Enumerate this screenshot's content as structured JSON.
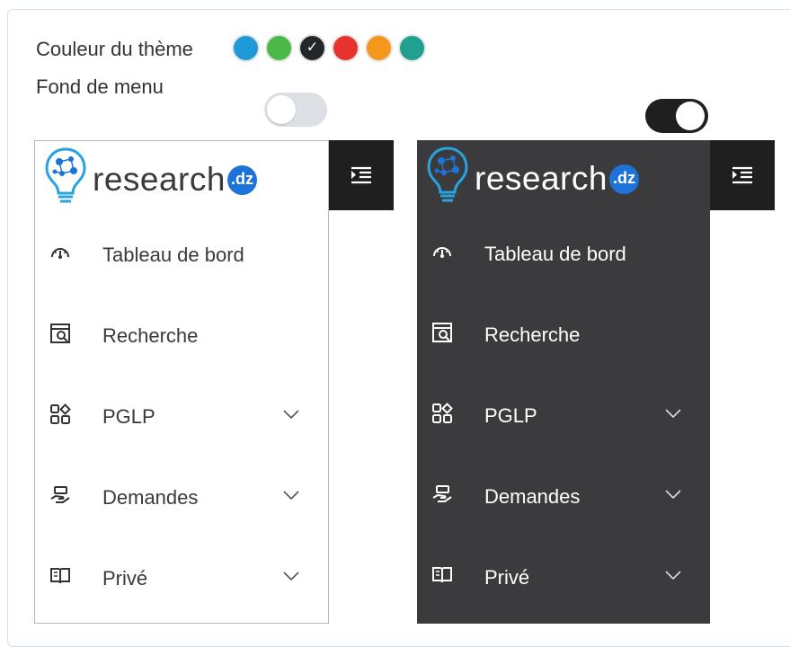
{
  "settings": {
    "theme_color_label": "Couleur du thème",
    "menu_background_label": "Fond de menu",
    "theme_colors": [
      {
        "name": "blue",
        "hex": "#1e9bd7",
        "selected": false
      },
      {
        "name": "green",
        "hex": "#4cb848",
        "selected": false
      },
      {
        "name": "black",
        "hex": "#23272b",
        "selected": true
      },
      {
        "name": "red",
        "hex": "#e8322d",
        "selected": false
      },
      {
        "name": "orange",
        "hex": "#f5961d",
        "selected": false
      },
      {
        "name": "teal",
        "hex": "#1fa090",
        "selected": false
      }
    ],
    "check_mark": "✓",
    "toggle_light_state": "off",
    "toggle_dark_state": "on"
  },
  "brand": {
    "name": "research",
    "badge": ".dz",
    "accent": "#1e73d8"
  },
  "menu": {
    "items": [
      {
        "label": "Tableau de bord",
        "icon": "dashboard-gauge-icon",
        "has_submenu": false
      },
      {
        "label": "Recherche",
        "icon": "search-document-icon",
        "has_submenu": false
      },
      {
        "label": "PGLP",
        "icon": "apps-grid-icon",
        "has_submenu": true
      },
      {
        "label": "Demandes",
        "icon": "hand-request-icon",
        "has_submenu": true
      },
      {
        "label": "Privé",
        "icon": "book-icon",
        "has_submenu": true
      }
    ]
  },
  "colors": {
    "dark_menu_bg": "#3b3b3d",
    "collapse_button_bg": "#1f1f1f",
    "toggle_off_bg": "#dcdfe4"
  }
}
